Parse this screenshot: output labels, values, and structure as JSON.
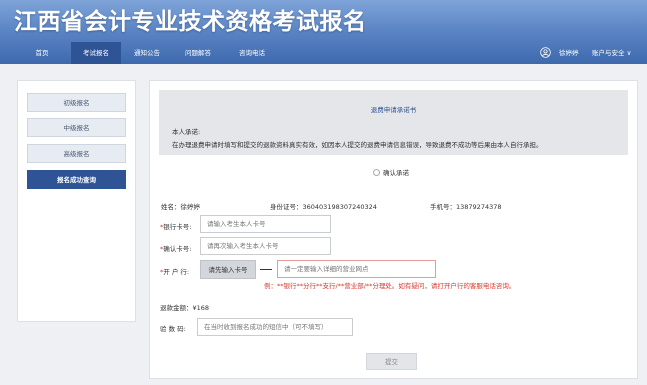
{
  "header": {
    "title": "江西省会计专业技术资格考试报名"
  },
  "nav": {
    "items": [
      "首页",
      "考试报名",
      "通知公告",
      "问题解答",
      "咨询电话"
    ],
    "active": "考试报名",
    "user_name": "徐婷婷",
    "account_label": "账户与安全 ∨",
    "user_icon": "user-icon"
  },
  "sidebar": {
    "items": [
      {
        "label": "初级报名",
        "active": false
      },
      {
        "label": "中级报名",
        "active": false
      },
      {
        "label": "高级报名",
        "active": false
      },
      {
        "label": "报名成功查询",
        "active": true
      }
    ]
  },
  "promise": {
    "title": "退费申请承诺书",
    "lead": "本人承诺:",
    "text": "在办理退费申请时填写和提交的退款资料真实有效，如因本人提交的退费申请信息错误，导致退费不成功等后果由本人自行承担。"
  },
  "confirm_label": "确认承诺",
  "info": {
    "name": "姓名：徐婷婷",
    "id": "身份证号：360403198307240324",
    "phone": "手机号：13879274378"
  },
  "form": {
    "bank_card": {
      "label": "银行卡号:",
      "placeholder": "请输入考生本人卡号"
    },
    "confirm_card": {
      "label": "确认卡号:",
      "placeholder": "请再次输入考生本人卡号"
    },
    "branch": {
      "label": "开 户 行:",
      "button": "请先输入卡号",
      "placeholder": "请一定要输入详细的营业网点",
      "hint": "例：**银行**分行**支行/**营业部/**分理处。如有疑问，请打开户行的客服电话咨询。"
    },
    "refund_amount": "退款金额：¥168",
    "verify": {
      "label": "验 数 码:",
      "placeholder": "在当时收到报名成功的短信中（可不填写）"
    },
    "submit": "提交"
  },
  "colors": {
    "primary": "#2f5496",
    "header_top": "#7fa4d8",
    "required": "#d9362b"
  }
}
